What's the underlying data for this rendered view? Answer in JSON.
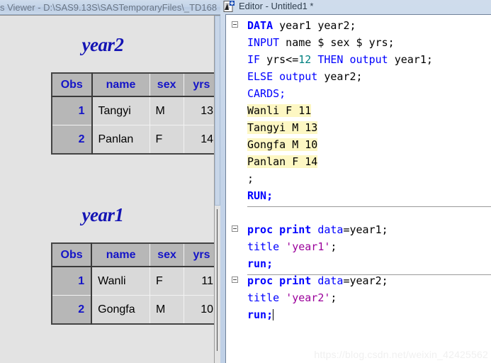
{
  "viewer": {
    "title": "s Viewer -  D:\\SAS9.13S\\SASTemporaryFiles\\_TD168",
    "reports": [
      {
        "title": "year2",
        "columns": [
          "Obs",
          "name",
          "sex",
          "yrs"
        ],
        "rows": [
          {
            "obs": "1",
            "name": "Tangyi",
            "sex": "M",
            "yrs": "13"
          },
          {
            "obs": "2",
            "name": "Panlan",
            "sex": "F",
            "yrs": "14"
          }
        ]
      },
      {
        "title": "year1",
        "columns": [
          "Obs",
          "name",
          "sex",
          "yrs"
        ],
        "rows": [
          {
            "obs": "1",
            "name": "Wanli",
            "sex": "F",
            "yrs": "11"
          },
          {
            "obs": "2",
            "name": "Gongfa",
            "sex": "M",
            "yrs": "10"
          }
        ]
      }
    ]
  },
  "editor": {
    "title": "Editor - Untitled1 *",
    "icon": "editor-document-icon",
    "lines": [
      {
        "fold": true,
        "tokens": [
          {
            "t": "DATA",
            "c": "kw"
          },
          {
            "t": " year1 year2;",
            "c": "plain"
          }
        ]
      },
      {
        "fold": false,
        "tokens": [
          {
            "t": "INPUT",
            "c": "kw2"
          },
          {
            "t": " name $ sex $ yrs;",
            "c": "plain"
          }
        ]
      },
      {
        "fold": false,
        "tokens": [
          {
            "t": "IF",
            "c": "kw2"
          },
          {
            "t": " yrs<=",
            "c": "plain"
          },
          {
            "t": "12",
            "c": "num"
          },
          {
            "t": " ",
            "c": "plain"
          },
          {
            "t": "THEN",
            "c": "kw2"
          },
          {
            "t": " ",
            "c": "plain"
          },
          {
            "t": "output",
            "c": "kw2"
          },
          {
            "t": " year1;",
            "c": "plain"
          }
        ]
      },
      {
        "fold": false,
        "tokens": [
          {
            "t": "ELSE",
            "c": "kw2"
          },
          {
            "t": " ",
            "c": "plain"
          },
          {
            "t": "output",
            "c": "kw2"
          },
          {
            "t": " year2;",
            "c": "plain"
          }
        ]
      },
      {
        "fold": false,
        "tokens": [
          {
            "t": "CARDS;",
            "c": "kw2"
          }
        ]
      },
      {
        "fold": false,
        "highlight": true,
        "tokens": [
          {
            "t": "Wanli F 11",
            "c": "plain"
          }
        ]
      },
      {
        "fold": false,
        "highlight": true,
        "tokens": [
          {
            "t": "Tangyi M 13",
            "c": "plain"
          }
        ]
      },
      {
        "fold": false,
        "highlight": true,
        "tokens": [
          {
            "t": "Gongfa M 10",
            "c": "plain"
          }
        ]
      },
      {
        "fold": false,
        "highlight": true,
        "tokens": [
          {
            "t": "Panlan F 14",
            "c": "plain"
          }
        ]
      },
      {
        "fold": false,
        "tokens": [
          {
            "t": ";",
            "c": "plain"
          }
        ]
      },
      {
        "fold": false,
        "tokens": [
          {
            "t": "RUN;",
            "c": "kw"
          }
        ]
      },
      {
        "fold": false,
        "tokens": []
      },
      {
        "fold": true,
        "tokens": [
          {
            "t": "proc",
            "c": "kw"
          },
          {
            "t": " ",
            "c": "plain"
          },
          {
            "t": "print",
            "c": "kw"
          },
          {
            "t": " ",
            "c": "plain"
          },
          {
            "t": "data",
            "c": "kw2"
          },
          {
            "t": "=year1;",
            "c": "plain"
          }
        ]
      },
      {
        "fold": false,
        "tokens": [
          {
            "t": "title",
            "c": "kw2"
          },
          {
            "t": " ",
            "c": "plain"
          },
          {
            "t": "'year1'",
            "c": "str"
          },
          {
            "t": ";",
            "c": "plain"
          }
        ]
      },
      {
        "fold": false,
        "tokens": [
          {
            "t": "run;",
            "c": "kw"
          }
        ]
      },
      {
        "fold": true,
        "tokens": [
          {
            "t": "proc",
            "c": "kw"
          },
          {
            "t": " ",
            "c": "plain"
          },
          {
            "t": "print",
            "c": "kw"
          },
          {
            "t": " ",
            "c": "plain"
          },
          {
            "t": "data",
            "c": "kw2"
          },
          {
            "t": "=year2;",
            "c": "plain"
          }
        ]
      },
      {
        "fold": false,
        "tokens": [
          {
            "t": "title",
            "c": "kw2"
          },
          {
            "t": " ",
            "c": "plain"
          },
          {
            "t": "'year2'",
            "c": "str"
          },
          {
            "t": ";",
            "c": "plain"
          }
        ]
      },
      {
        "fold": false,
        "caret": true,
        "tokens": [
          {
            "t": "run;",
            "c": "kw"
          }
        ]
      }
    ],
    "separator_after_lines": [
      10,
      14
    ]
  },
  "watermark": "https://blog.csdn.net/weixin_42425562",
  "colors": {
    "keyword": "#0000ff",
    "string": "#9b009b",
    "number": "#008080",
    "highlight": "#fdf7c3",
    "report_title": "#1414b4",
    "table_header_text": "#1414c8"
  }
}
